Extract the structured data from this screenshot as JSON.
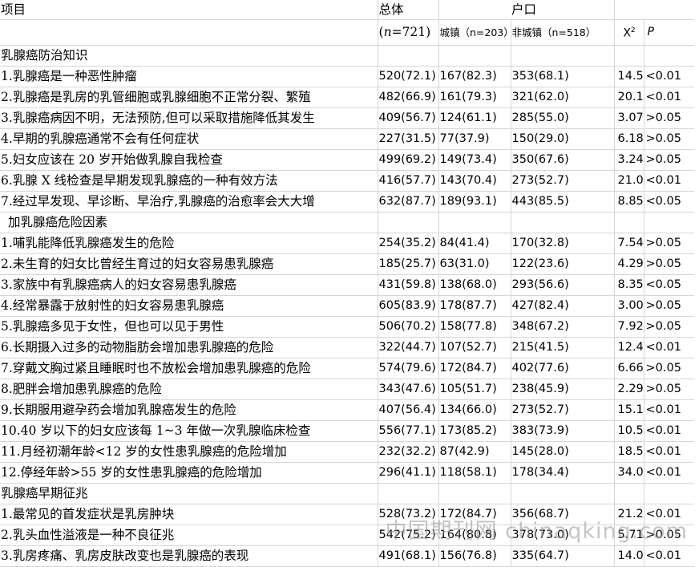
{
  "header": {
    "item": "项目",
    "total": "总体",
    "total_n_prefix": "(",
    "total_n_italic": "n",
    "total_n_rest": "=721)",
    "household": "户口",
    "urban": "城镇（n=203）",
    "rural": "非城镇（n=518）",
    "chi": "X",
    "chi_sup": "2",
    "p": "P"
  },
  "sections": [
    {
      "title": "乳腺癌防治知识",
      "rows": [
        {
          "item": "1.乳腺癌是一种恶性肿瘤",
          "total": "520(72.1)",
          "urban": "167(82.3)",
          "rural": "353(68.1)",
          "chi": "14.56",
          "p": "<0.01"
        },
        {
          "item": "2.乳腺癌是乳房的乳管细胞或乳腺细胞不正常分裂、繁殖",
          "total": "482(66.9)",
          "urban": "161(79.3)",
          "rural": "321(62.0)",
          "chi": "20.10",
          "p": "<0.01"
        },
        {
          "item": "3.乳腺癌病因不明，无法预防,但可以采取措施降低其发生",
          "total": "409(56.7)",
          "urban": "124(61.1)",
          "rural": "285(55.0)",
          "chi": "3.07",
          "p": ">0.05"
        },
        {
          "item": "4.早期的乳腺癌通常不会有任何症状",
          "total": "227(31.5)",
          "urban": "77(37.9)",
          "rural": "150(29.0)",
          "chi": "6.18",
          "p": ">0.05"
        },
        {
          "item": "5.妇女应该在 20 岁开始做乳腺自我检查",
          "total": "499(69.2)",
          "urban": "149(73.4)",
          "rural": "350(67.6)",
          "chi": "3.24",
          "p": ">0.05"
        },
        {
          "item": "6.乳腺 X 线检查是早期发现乳腺癌的一种有效方法",
          "total": "416(57.7)",
          "urban": "143(70.4)",
          "rural": "273(52.7)",
          "chi": "21.02",
          "p": "<0.01"
        },
        {
          "item": "7.经过早发现、早诊断、早治疗,乳腺癌的治愈率会大大增",
          "total": "632(87.7)",
          "urban": "189(93.1)",
          "rural": "443(85.5)",
          "chi": "8.85",
          "p": "<0.05"
        }
      ]
    },
    {
      "title": "加乳腺癌危险因素",
      "rows": [
        {
          "item": "1.哺乳能降低乳腺癌发生的危险",
          "total": "254(35.2)",
          "urban": "84(41.4)",
          "rural": "170(32.8)",
          "chi": "7.54",
          "p": ">0.05"
        },
        {
          "item": "2.未生育的妇女比曾经生育过的妇女容易患乳腺癌",
          "total": "185(25.7)",
          "urban": "63(31.0)",
          "rural": "122(23.6)",
          "chi": "4.29",
          "p": ">0.05"
        },
        {
          "item": "3.家族中有乳腺癌病人的妇女容易患乳腺癌",
          "total": "431(59.8)",
          "urban": "138(68.0)",
          "rural": "293(56.6)",
          "chi": "8.35",
          "p": "<0.05"
        },
        {
          "item": "4.经常暴露于放射性的妇女容易患乳腺癌",
          "total": "605(83.9)",
          "urban": "178(87.7)",
          "rural": "427(82.4)",
          "chi": "3.00",
          "p": ">0.05"
        },
        {
          "item": "5.乳腺癌多见于女性，但也可以见于男性",
          "total": "506(70.2)",
          "urban": "158(77.8)",
          "rural": "348(67.2)",
          "chi": "7.92",
          "p": ">0.05"
        },
        {
          "item": "6.长期摄入过多的动物脂肪会增加患乳腺癌的危险",
          "total": "322(44.7)",
          "urban": "107(52.7)",
          "rural": "215(41.5)",
          "chi": "12.44",
          "p": "<0.01"
        },
        {
          "item": "7.穿戴文胸过紧且睡眠时也不放松会增加患乳腺癌的危险",
          "total": "574(79.6)",
          "urban": "172(84.7)",
          "rural": "402(77.6)",
          "chi": "6.66",
          "p": ">0.05"
        },
        {
          "item": "8.肥胖会增加患乳腺癌的危险",
          "total": "343(47.6)",
          "urban": "105(51.7)",
          "rural": "238(45.9)",
          "chi": "2.29",
          "p": ">0.05"
        },
        {
          "item": "9.长期服用避孕药会增加乳腺癌发生的危险",
          "total": "407(56.4)",
          "urban": "134(66.0)",
          "rural": "273(52.7)",
          "chi": "15.19",
          "p": "<0.01"
        },
        {
          "item": "10.40 岁以下的妇女应该每 1~3 年做一次乳腺临床检查",
          "total": "556(77.1)",
          "urban": "173(85.2)",
          "rural": "383(73.9)",
          "chi": "10.53",
          "p": "<0.01"
        },
        {
          "item": "11.月经初潮年龄<12 岁的女性患乳腺癌的危险增加",
          "total": "232(32.2)",
          "urban": "87(42.9)",
          "rural": "145(28.0)",
          "chi": "18.54",
          "p": "<0.01"
        },
        {
          "item": "12.停经年龄>55 岁的女性患乳腺癌的危险增加",
          "total": "296(41.1)",
          "urban": "118(58.1)",
          "rural": "178(34.4)",
          "chi": "34.04",
          "p": "<0.01"
        }
      ]
    },
    {
      "title": "乳腺癌早期征兆",
      "rows": [
        {
          "item": "1.最常见的首发症状是乳房肿块",
          "total": "528(73.2)",
          "urban": "172(84.7)",
          "rural": "356(68.7)",
          "chi": "21.20",
          "p": "<0.01"
        },
        {
          "item": "2.乳头血性溢液是一种不良征兆",
          "total": "542(75.2)",
          "urban": "164(80.8)",
          "rural": "378(73.0)",
          "chi": "5.71",
          "p": ">0.05"
        },
        {
          "item": "3.乳房疼痛、乳房皮肤改变也是乳腺癌的表现",
          "total": "491(68.1)",
          "urban": "156(76.8)",
          "rural": "335(64.7)",
          "chi": "14.04",
          "p": "<0.01"
        }
      ]
    }
  ],
  "watermark": "中国期刊网 chinaqking.com"
}
